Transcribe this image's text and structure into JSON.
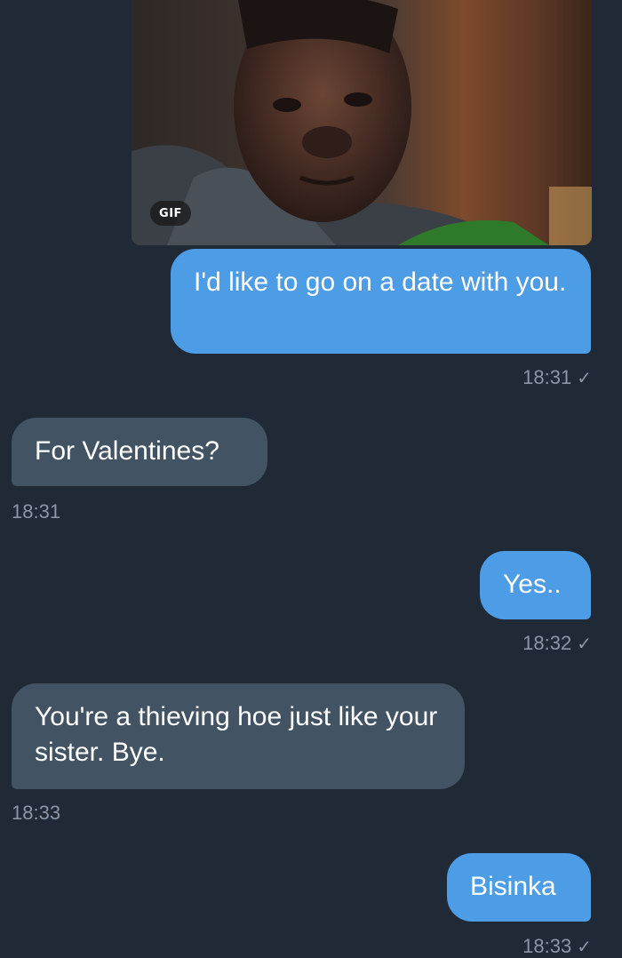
{
  "messages": [
    {
      "direction": "outgoing",
      "type": "gif",
      "badge": "GIF"
    },
    {
      "direction": "outgoing",
      "text": "I'd like to go on a date with you.",
      "time": "18:31",
      "status_icon": "check-icon",
      "status_glyph": "✓"
    },
    {
      "direction": "incoming",
      "text": "For Valentines?",
      "time": "18:31"
    },
    {
      "direction": "outgoing",
      "text": "Yes..",
      "time": "18:32",
      "status_icon": "check-icon",
      "status_glyph": "✓"
    },
    {
      "direction": "incoming",
      "text": "You're a thieving hoe just like your sister. Bye.",
      "time": "18:33"
    },
    {
      "direction": "outgoing",
      "text": "Bisinka",
      "time": "18:33",
      "status_icon": "check-icon",
      "status_glyph": "✓"
    }
  ],
  "colors": {
    "background": "#202936",
    "outgoing_bubble": "#4c9ce6",
    "incoming_bubble": "#425364",
    "timestamp": "#8a97a6"
  }
}
